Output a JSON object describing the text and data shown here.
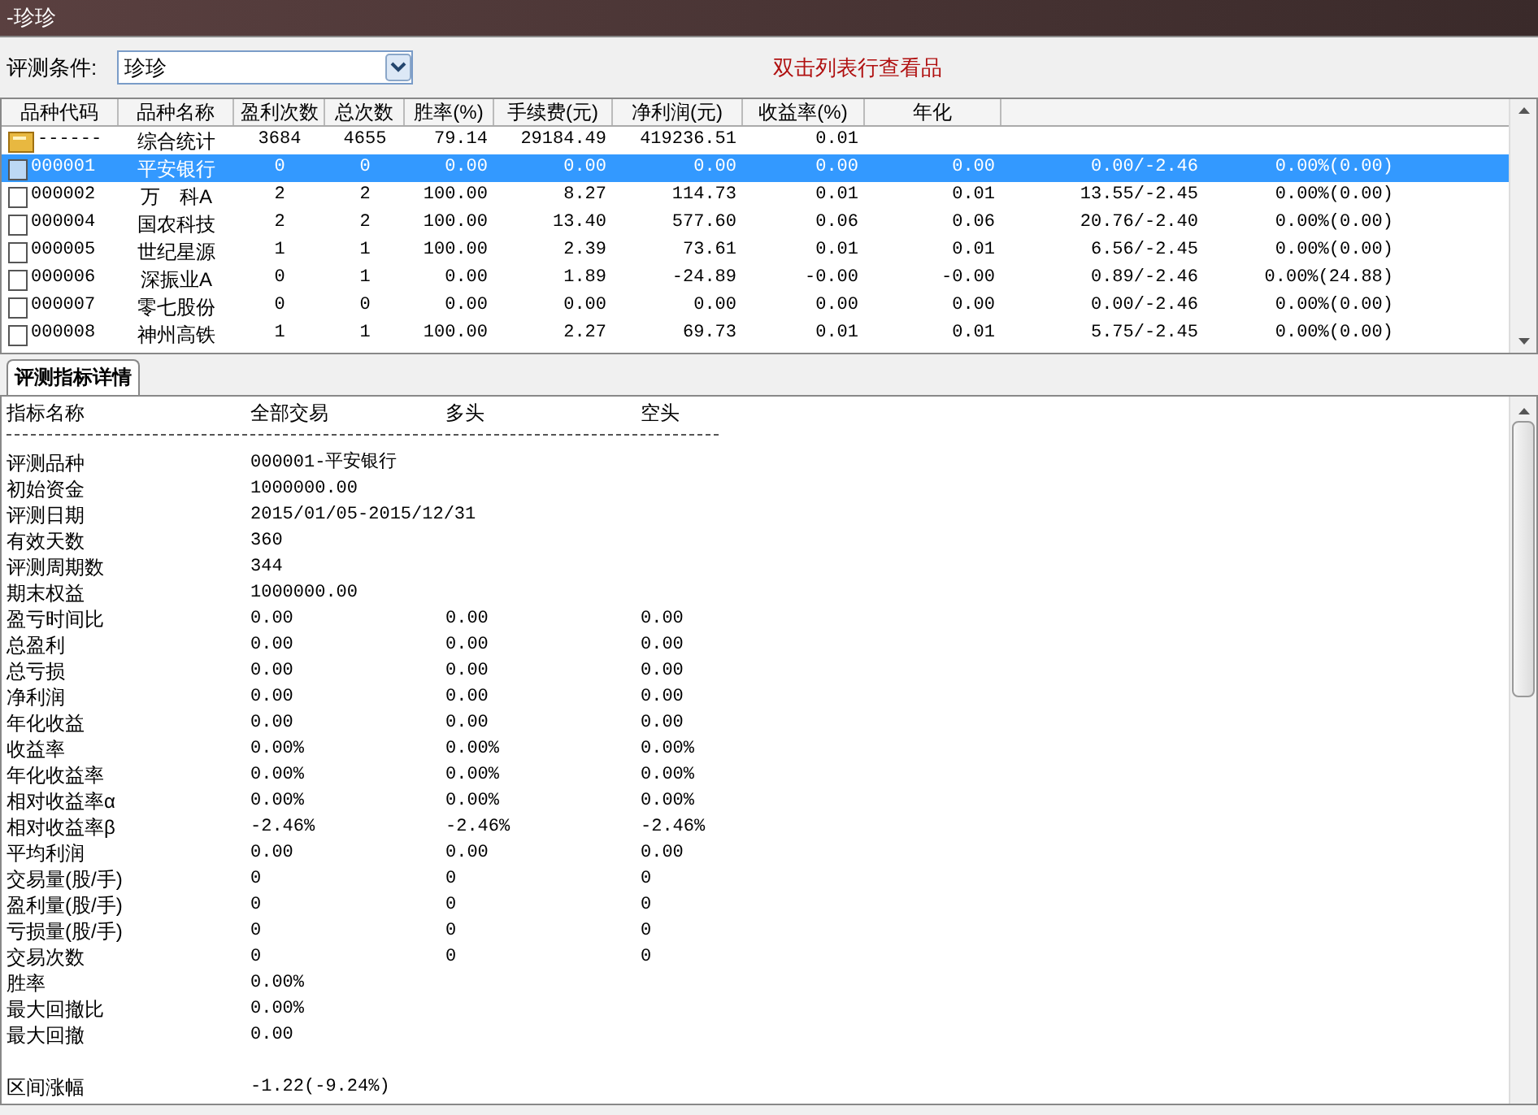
{
  "window": {
    "title": "-珍珍"
  },
  "condition": {
    "label": "评测条件:",
    "value": "珍珍"
  },
  "hint": "双击列表行查看品",
  "table": {
    "columns": [
      "品种代码",
      "品种名称",
      "盈利次数",
      "总次数",
      "胜率(%)",
      "手续费(元)",
      "净利润(元)",
      "收益率(%)",
      "年化"
    ],
    "rows": [
      {
        "kind": "summary",
        "selected": false,
        "cells": [
          "------",
          "综合统计",
          "3684",
          "4655",
          "79.14",
          "29184.49",
          "419236.51",
          "0.01"
        ]
      },
      {
        "kind": "stock",
        "selected": true,
        "cells": [
          "000001",
          "平安银行",
          "0",
          "0",
          "0.00",
          "0.00",
          "0.00",
          "0.00",
          "0.00",
          "0.00/-2.46",
          "0.00%(0.00)"
        ]
      },
      {
        "kind": "stock",
        "selected": false,
        "cells": [
          "000002",
          "万　科A",
          "2",
          "2",
          "100.00",
          "8.27",
          "114.73",
          "0.01",
          "0.01",
          "13.55/-2.45",
          "0.00%(0.00)"
        ]
      },
      {
        "kind": "stock",
        "selected": false,
        "cells": [
          "000004",
          "国农科技",
          "2",
          "2",
          "100.00",
          "13.40",
          "577.60",
          "0.06",
          "0.06",
          "20.76/-2.40",
          "0.00%(0.00)"
        ]
      },
      {
        "kind": "stock",
        "selected": false,
        "cells": [
          "000005",
          "世纪星源",
          "1",
          "1",
          "100.00",
          "2.39",
          "73.61",
          "0.01",
          "0.01",
          "6.56/-2.45",
          "0.00%(0.00)"
        ]
      },
      {
        "kind": "stock",
        "selected": false,
        "cells": [
          "000006",
          "深振业A",
          "0",
          "1",
          "0.00",
          "1.89",
          "-24.89",
          "-0.00",
          "-0.00",
          "0.89/-2.46",
          "0.00%(24.88)"
        ]
      },
      {
        "kind": "stock",
        "selected": false,
        "cells": [
          "000007",
          "零七股份",
          "0",
          "0",
          "0.00",
          "0.00",
          "0.00",
          "0.00",
          "0.00",
          "0.00/-2.46",
          "0.00%(0.00)"
        ]
      },
      {
        "kind": "stock",
        "selected": false,
        "cells": [
          "000008",
          "神州高铁",
          "1",
          "1",
          "100.00",
          "2.27",
          "69.73",
          "0.01",
          "0.01",
          "5.75/-2.45",
          "0.00%(0.00)"
        ]
      }
    ]
  },
  "tabs": [
    {
      "label": "评测指标详情",
      "selected": true
    }
  ],
  "details": {
    "columns": [
      "指标名称",
      "全部交易",
      "多头",
      "空头"
    ],
    "rows": [
      [
        "评测品种",
        "000001-平安银行"
      ],
      [
        "初始资金",
        "1000000.00"
      ],
      [
        "评测日期",
        "2015/01/05-2015/12/31"
      ],
      [
        "有效天数",
        "360"
      ],
      [
        "评测周期数",
        "344"
      ],
      [
        "期末权益",
        "1000000.00"
      ],
      [
        "盈亏时间比",
        "0.00",
        "0.00",
        "0.00"
      ],
      [
        "总盈利",
        "0.00",
        "0.00",
        "0.00"
      ],
      [
        "总亏损",
        "0.00",
        "0.00",
        "0.00"
      ],
      [
        "净利润",
        "0.00",
        "0.00",
        "0.00"
      ],
      [
        "年化收益",
        "0.00",
        "0.00",
        "0.00"
      ],
      [
        "收益率",
        "0.00%",
        "0.00%",
        "0.00%"
      ],
      [
        "年化收益率",
        "0.00%",
        "0.00%",
        "0.00%"
      ],
      [
        "相对收益率α",
        "0.00%",
        "0.00%",
        "0.00%"
      ],
      [
        "相对收益率β",
        "-2.46%",
        "-2.46%",
        "-2.46%"
      ],
      [
        "平均利润",
        "0.00",
        "0.00",
        "0.00"
      ],
      [
        "交易量(股/手)",
        "0",
        "0",
        "0"
      ],
      [
        "盈利量(股/手)",
        "0",
        "0",
        "0"
      ],
      [
        "亏损量(股/手)",
        "0",
        "0",
        "0"
      ],
      [
        "交易次数",
        "0",
        "0",
        "0"
      ],
      [
        "胜率",
        "0.00%"
      ],
      [
        "最大回撤比",
        "0.00%"
      ],
      [
        "最大回撤",
        "0.00"
      ],
      [],
      [
        "区间涨幅",
        "-1.22(-9.24%)"
      ]
    ]
  }
}
